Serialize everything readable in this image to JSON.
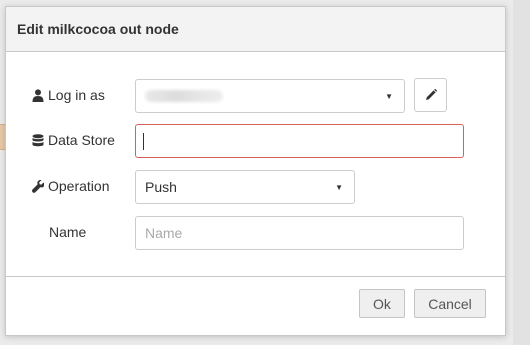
{
  "dialog": {
    "title": "Edit milkcocoa out node"
  },
  "form": {
    "login": {
      "label": "Log in as",
      "icon": "user-icon"
    },
    "datastore": {
      "label": "Data Store",
      "icon": "database-icon",
      "value": ""
    },
    "operation": {
      "label": "Operation",
      "icon": "wrench-icon",
      "value": "Push"
    },
    "name": {
      "label": "Name",
      "placeholder": "Name"
    },
    "edit_icon": "pencil-icon"
  },
  "footer": {
    "ok_label": "Ok",
    "cancel_label": "Cancel"
  },
  "colors": {
    "invalid_border": "#d6615c",
    "header_bg": "#f3f3f3"
  }
}
